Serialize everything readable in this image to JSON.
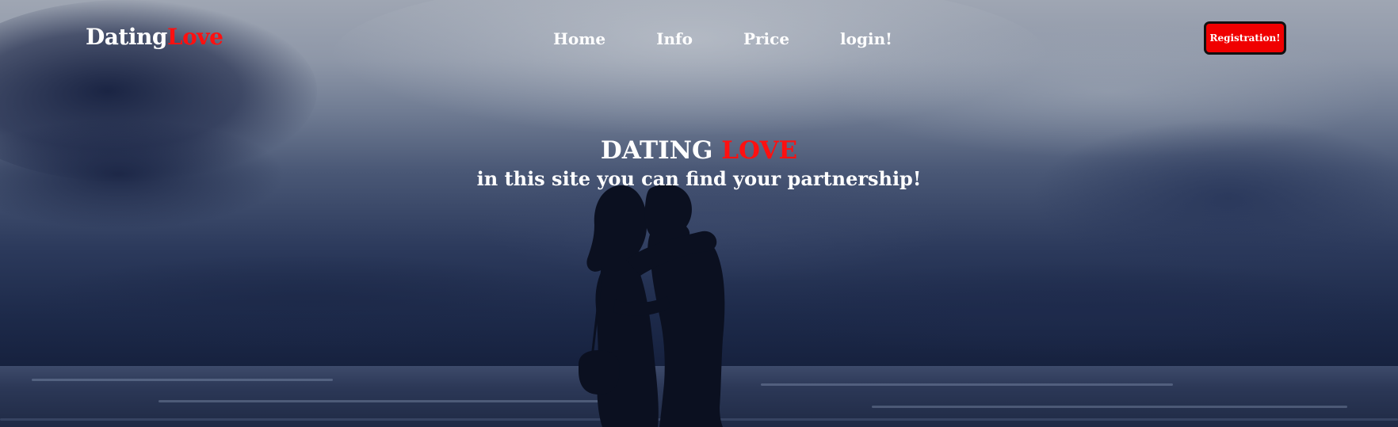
{
  "header": {
    "logo_part1": "Dating",
    "logo_part2": "Love",
    "nav": {
      "home": "Home",
      "info": "Info",
      "price": "Price",
      "login": "login!"
    },
    "register_label": "Registration!"
  },
  "hero": {
    "title_part1": "DATING ",
    "title_part2": "LOVE",
    "subtitle": "in this site you can find your partnership!"
  },
  "colors": {
    "accent": "#ff1010",
    "button": "#f00000",
    "text": "#ffffff"
  }
}
